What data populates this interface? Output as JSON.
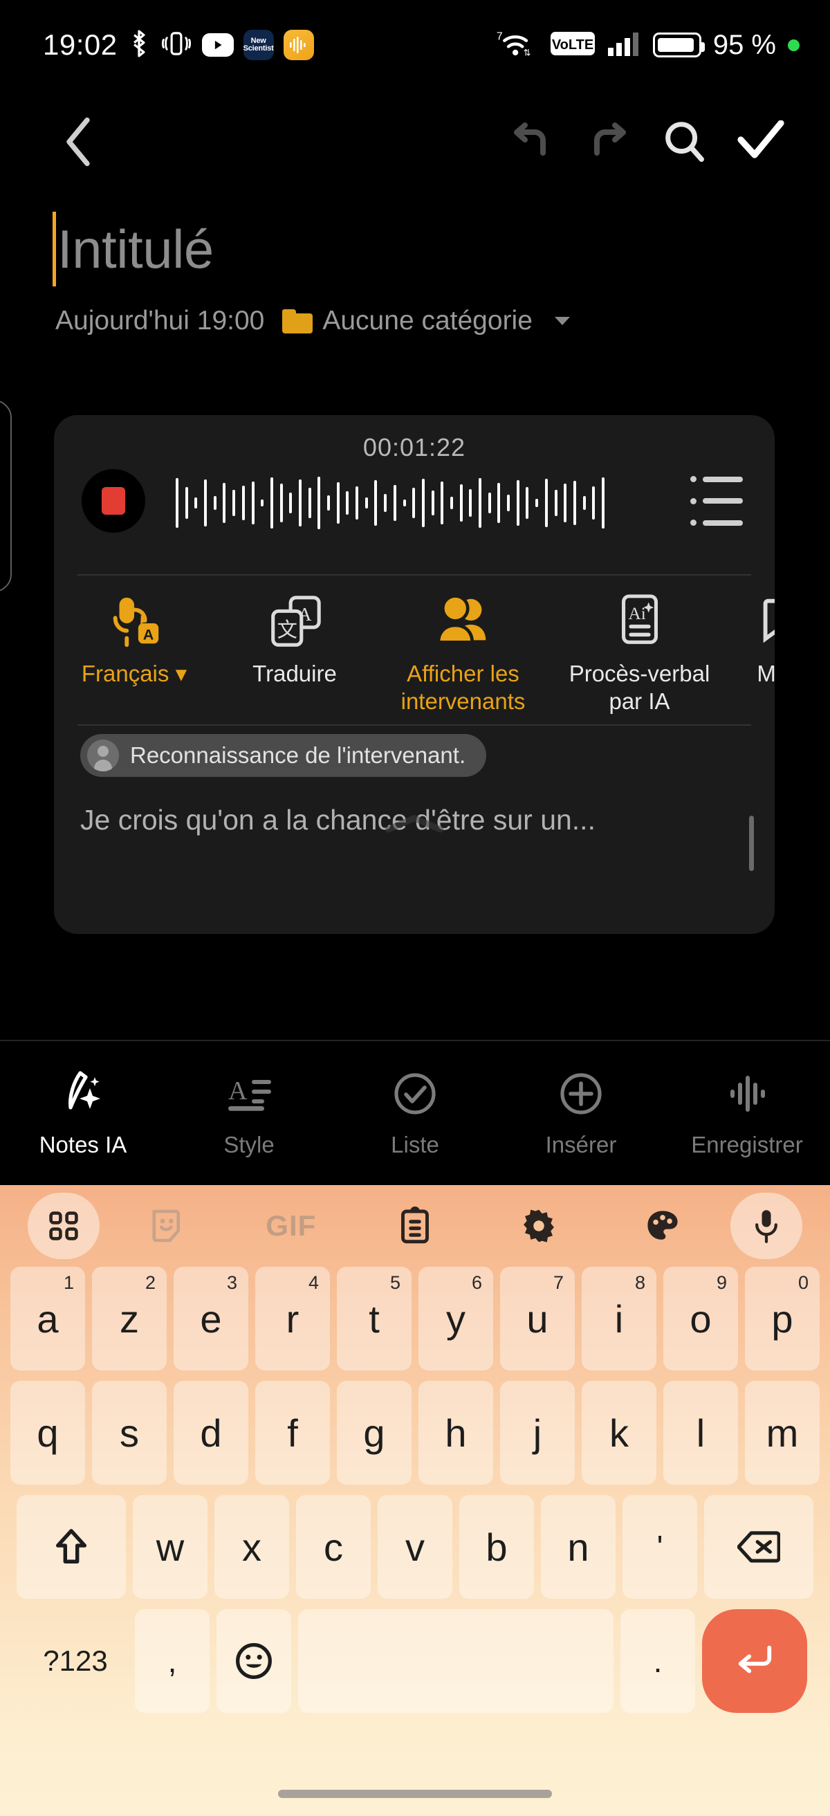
{
  "status_bar": {
    "time": "19:02",
    "icons_left": [
      "bluetooth-icon",
      "vibrate-icon",
      "youtube-app-icon",
      "new-scientist-app-icon",
      "recorder-app-icon"
    ],
    "new_scientist_label": "New Scientist",
    "wifi_generation": "7",
    "volte_label": "VoLTE",
    "battery_percent": "95 %",
    "icons_right": [
      "wifi-icon",
      "volte-icon",
      "signal-icon",
      "battery-icon",
      "recording-indicator-dot"
    ],
    "accent_green": "#2ddb4f"
  },
  "top_toolbar": {
    "back": "back-chevron",
    "undo": "undo-arrow",
    "redo": "redo-arrow",
    "search": "search-magnifier",
    "confirm": "check-mark"
  },
  "note": {
    "title_placeholder": "Intitulé",
    "date": "Aujourd'hui 19:00",
    "category": "Aucune catégorie",
    "category_caret": "▾",
    "folder_color": "#e0a017",
    "caret_color": "#f5a623"
  },
  "recorder": {
    "timer": "00:01:22",
    "stop_button": "stop-recording",
    "list_button": "transcript-list",
    "stop_color": "#e23c33",
    "waveform_bars": [
      72,
      46,
      16,
      68,
      20,
      58,
      38,
      50,
      62,
      10,
      74,
      56,
      30,
      68,
      44,
      76,
      22,
      60,
      34,
      48,
      16,
      66,
      26,
      52,
      10,
      44,
      70,
      36,
      62,
      18,
      54,
      40,
      72,
      30,
      58,
      24,
      66,
      46,
      12,
      70,
      38,
      56,
      64,
      20,
      48,
      74
    ]
  },
  "actions": [
    {
      "label": "Français",
      "icon": "voice-language-icon",
      "caret": "▾",
      "highlighted": true
    },
    {
      "label": "Traduire",
      "icon": "translate-icon",
      "highlighted": false
    },
    {
      "label": "Afficher les intervenants",
      "icon": "speakers-icon",
      "highlighted": true
    },
    {
      "label": "Procès-verbal par IA",
      "icon": "ai-minutes-icon",
      "highlighted": false
    },
    {
      "label": "Marq",
      "icon": "bookmark-icon",
      "highlighted": false
    }
  ],
  "transcript": {
    "speaker_badge": "Reconnaissance de l'intervenant.",
    "text": "Je crois qu'on a la chance d'être sur un...",
    "collapse": "collapse-chevron"
  },
  "format_bar": [
    {
      "label": "Notes IA",
      "icon": "ai-notes-icon",
      "active": true
    },
    {
      "label": "Style",
      "icon": "text-style-icon",
      "active": false
    },
    {
      "label": "Liste",
      "icon": "checklist-icon",
      "active": false
    },
    {
      "label": "Insérer",
      "icon": "insert-plus-icon",
      "active": false
    },
    {
      "label": "Enregistrer",
      "icon": "record-waveform-icon",
      "active": false
    }
  ],
  "keyboard": {
    "toolbar": [
      "apps-grid-icon",
      "sticker-icon",
      "gif-icon",
      "clipboard-icon",
      "settings-gear-icon",
      "theme-palette-icon",
      "microphone-icon"
    ],
    "gif_label": "GIF",
    "row1": [
      {
        "k": "a",
        "n": "1"
      },
      {
        "k": "z",
        "n": "2"
      },
      {
        "k": "e",
        "n": "3"
      },
      {
        "k": "r",
        "n": "4"
      },
      {
        "k": "t",
        "n": "5"
      },
      {
        "k": "y",
        "n": "6"
      },
      {
        "k": "u",
        "n": "7"
      },
      {
        "k": "i",
        "n": "8"
      },
      {
        "k": "o",
        "n": "9"
      },
      {
        "k": "p",
        "n": "0"
      }
    ],
    "row2": [
      "q",
      "s",
      "d",
      "f",
      "g",
      "h",
      "j",
      "k",
      "l",
      "m"
    ],
    "row3": [
      "w",
      "x",
      "c",
      "v",
      "b",
      "n",
      "'"
    ],
    "shift": "shift-key",
    "backspace": "backspace-key",
    "symbols_label": "?123",
    "comma": ",",
    "emoji": "emoji-key",
    "space": "space-key",
    "period": ".",
    "enter": "enter-key",
    "enter_color": "#ef6b4e"
  }
}
